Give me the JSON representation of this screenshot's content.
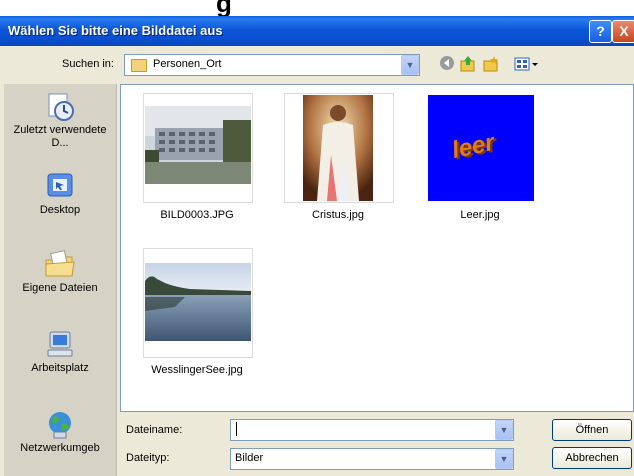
{
  "dialog": {
    "title": "Wählen Sie bitte eine Bilddatei aus",
    "help_label": "?",
    "close_label": "X"
  },
  "lookin": {
    "label": "Suchen in:",
    "folder": "Personen_Ort"
  },
  "places": [
    {
      "label": "Zuletzt verwendete D...",
      "icon": "recent-documents-icon"
    },
    {
      "label": "Desktop",
      "icon": "desktop-icon"
    },
    {
      "label": "Eigene Dateien",
      "icon": "my-documents-icon"
    },
    {
      "label": "Arbeitsplatz",
      "icon": "my-computer-icon"
    },
    {
      "label": "Netzwerkumgeb",
      "icon": "network-places-icon"
    }
  ],
  "files": [
    {
      "name": "BILD0003.JPG"
    },
    {
      "name": "Cristus.jpg"
    },
    {
      "name": "Leer.jpg",
      "thumb_text": "leer"
    },
    {
      "name": "WesslingerSee.jpg"
    }
  ],
  "filename": {
    "label": "Dateiname:",
    "value": ""
  },
  "filetype": {
    "label": "Dateityp:",
    "value": "Bilder"
  },
  "buttons": {
    "open": "Öffnen",
    "cancel": "Abbrechen"
  },
  "colors": {
    "titlebar": "#0a4fcf",
    "dialog_bg": "#ece9d8",
    "leer_bg": "#0000ff"
  }
}
